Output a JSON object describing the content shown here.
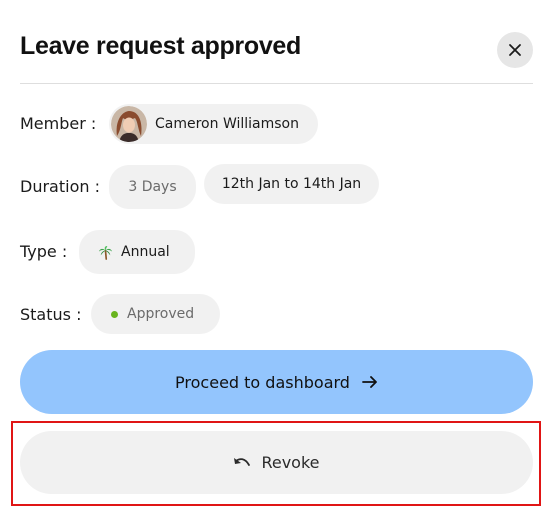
{
  "dialog": {
    "title": "Leave request approved"
  },
  "details": {
    "member_label": "Member :",
    "member_name": "Cameron Williamson",
    "duration_label": "Duration :",
    "duration_days": "3 Days",
    "duration_range": "12th Jan to 14th Jan",
    "type_label": "Type :",
    "type_value": "Annual",
    "type_icon": "palm-tree-icon",
    "status_label": "Status :",
    "status_value": "Approved",
    "status_color": "#69b41e"
  },
  "actions": {
    "proceed_label": "Proceed to dashboard",
    "proceed_icon": "arrow-right-icon",
    "revoke_label": "Revoke",
    "revoke_icon": "undo-icon"
  },
  "colors": {
    "primary": "#93c5fd",
    "chip_bg": "#f1f1f1",
    "highlight": "#e01515"
  }
}
